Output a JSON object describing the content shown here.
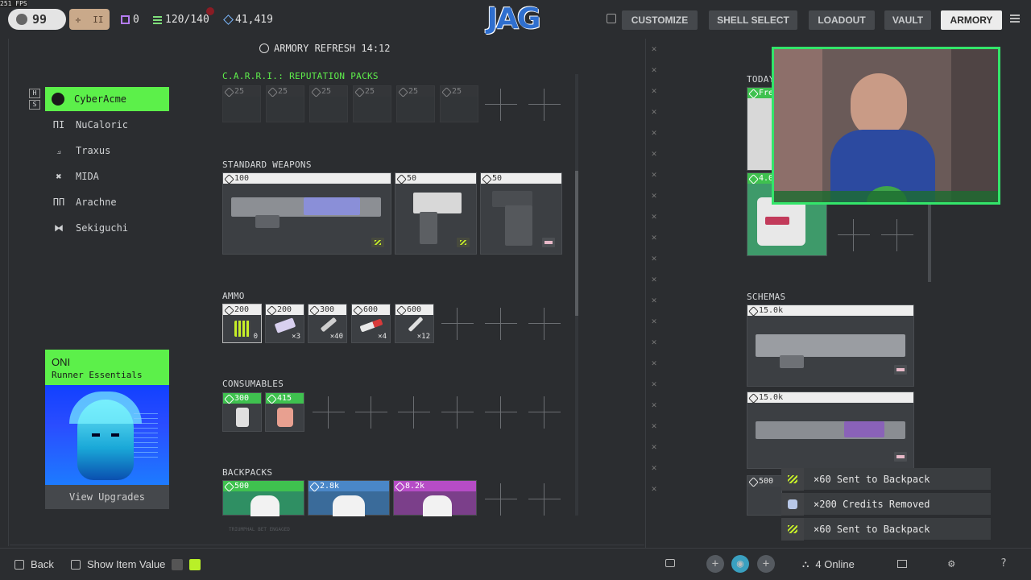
{
  "overlay": {
    "fps": "251 FPS"
  },
  "topbar": {
    "level": "99",
    "level_icon": "runner-icon",
    "slot_a": "II",
    "stat_items": "0",
    "stat_inventory": "120/140",
    "stat_credits": "41,419",
    "logo": "JAG",
    "nav": [
      "CUSTOMIZE",
      "SHELL SELECT",
      "LOADOUT",
      "VAULT",
      "ARMORY"
    ],
    "nav_active": "ARMORY",
    "accent": "#5cf04a"
  },
  "sidebar": {
    "hotkeys": [
      "H",
      "S"
    ],
    "corps": [
      {
        "label": "CyberAcme",
        "icon": "cyberacme-icon",
        "active": true
      },
      {
        "label": "NuCaloric",
        "icon": "nucaloric-icon"
      },
      {
        "label": "Traxus",
        "icon": "traxus-icon"
      },
      {
        "label": "MIDA",
        "icon": "mida-icon"
      },
      {
        "label": "Arachne",
        "icon": "arachne-icon"
      },
      {
        "label": "Sekiguchi",
        "icon": "sekiguchi-icon"
      }
    ],
    "promo": {
      "title": "ONI",
      "subtitle": "Runner Essentials",
      "button": "View Upgrades"
    }
  },
  "main": {
    "refresh": "ARMORY REFRESH 14:12",
    "sections": {
      "reputation": {
        "title": "C.A.R.R.I.: REPUTATION PACKS",
        "prices": [
          "25",
          "25",
          "25",
          "25",
          "25",
          "25"
        ]
      },
      "weapons": {
        "title": "STANDARD WEAPONS",
        "prices": [
          "100",
          "50",
          "50"
        ]
      },
      "ammo": {
        "title": "AMMO",
        "items": [
          {
            "price": "200",
            "qty": "0"
          },
          {
            "price": "200",
            "qty": "×3"
          },
          {
            "price": "300",
            "qty": "×40"
          },
          {
            "price": "600",
            "qty": "×4"
          },
          {
            "price": "600",
            "qty": "×12"
          }
        ]
      },
      "consumables": {
        "title": "CONSUMABLES",
        "prices": [
          "300",
          "415"
        ]
      },
      "backpacks": {
        "title": "BACKPACKS",
        "prices": [
          "500",
          "2.8k",
          "8.2k"
        ]
      }
    },
    "footer_text": "TRIUMPHAL BET ENGAGED"
  },
  "right": {
    "today_title": "TODAY",
    "today_free": "Fre",
    "today_price": "4.0",
    "schemas": {
      "title": "SCHEMAS",
      "prices": [
        "15.0k",
        "15.0k",
        "500"
      ]
    }
  },
  "toasts": [
    {
      "text": "×60 Sent to Backpack",
      "icon": "ammo-icon"
    },
    {
      "text": "×200 Credits Removed",
      "icon": "credits-icon"
    },
    {
      "text": "×60 Sent to Backpack",
      "icon": "ammo-icon"
    }
  ],
  "bottom": {
    "back": "Back",
    "show_value": "Show Item Value",
    "online": "4 Online"
  }
}
